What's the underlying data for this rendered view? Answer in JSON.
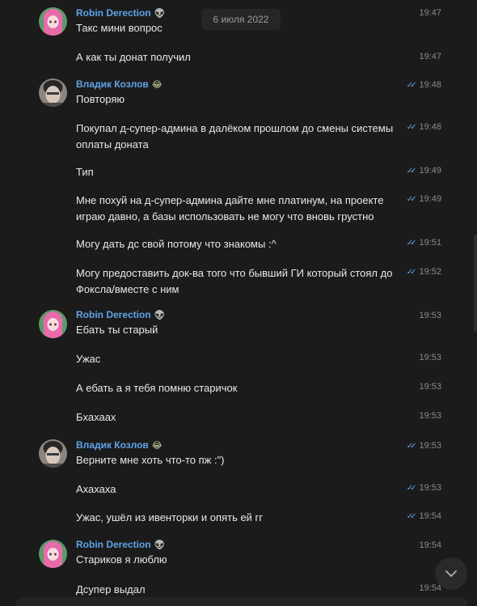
{
  "date_separator": "6 июля 2022",
  "users": {
    "robin": {
      "name": "Robin Derection",
      "emoji": "👽"
    },
    "vladik": {
      "name": "Владик Козлов",
      "emoji": "😂"
    }
  },
  "messages": [
    {
      "user": "robin",
      "text": "Такс мини вопрос",
      "time": "19:47",
      "read": false
    },
    {
      "user": "robin",
      "text": "А как ты донат получил",
      "time": "19:47",
      "read": false
    },
    {
      "user": "vladik",
      "text": "Повторяю",
      "time": "19:48",
      "read": true
    },
    {
      "user": "vladik",
      "text": "Покупал д-супер-админа в далёком прошлом до смены системы оплаты доната",
      "time": "19:48",
      "read": true
    },
    {
      "user": "vladik",
      "text": "Тип",
      "time": "19:49",
      "read": true
    },
    {
      "user": "vladik",
      "text": "Мне похуй на д-супер-админа дайте мне платинум, на проекте играю давно, а базы использовать не могу что вновь грустно",
      "time": "19:49",
      "read": true
    },
    {
      "user": "vladik",
      "text": "Могу дать дс свой потому что знакомы :^",
      "time": "19:51",
      "read": true
    },
    {
      "user": "vladik",
      "text": "Могу предоставить док-ва того что бывший ГИ который стоял до Фоксла/вместе с ним",
      "time": "19:52",
      "read": true
    },
    {
      "user": "robin",
      "text": "Ебать ты старый",
      "time": "19:53",
      "read": false
    },
    {
      "user": "robin",
      "text": "Ужас",
      "time": "19:53",
      "read": false
    },
    {
      "user": "robin",
      "text": "А ебать а я тебя помню старичок",
      "time": "19:53",
      "read": false
    },
    {
      "user": "robin",
      "text": "Бхахаах",
      "time": "19:53",
      "read": false
    },
    {
      "user": "vladik",
      "text": "Верните мне хоть что-то пж :\")",
      "time": "19:53",
      "read": true
    },
    {
      "user": "vladik",
      "text": "Ахахаха",
      "time": "19:53",
      "read": true
    },
    {
      "user": "vladik",
      "text": "Ужас, ушёл из ивенторки и опять ей гг",
      "time": "19:54",
      "read": true
    },
    {
      "user": "robin",
      "text": "Стариков я люблю",
      "time": "19:54",
      "read": false
    },
    {
      "user": "robin",
      "text": "Дсупер выдал",
      "time": "19:54",
      "read": false
    }
  ],
  "colors": {
    "background": "#1b1b1b",
    "username": "#5fa4e8",
    "read_check": "#5fa4e8",
    "timestamp": "#8a8a8a"
  },
  "icons": {
    "read_receipt": "double-check-icon",
    "scroll_down": "chevron-down-icon"
  }
}
